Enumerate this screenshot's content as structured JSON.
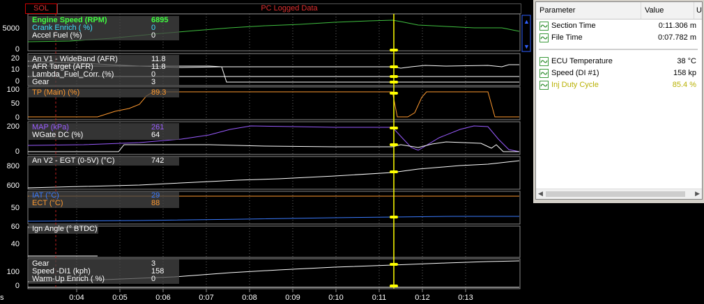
{
  "header": {
    "sol_label": "SOL",
    "title": "PC Logged Data"
  },
  "panels": [
    {
      "id": "engine",
      "yticks": [
        "5000",
        "0"
      ],
      "channels": [
        {
          "label": "Engine Speed (RPM)",
          "value": "6895",
          "color": "#40ff40"
        },
        {
          "label": "Crank Enrich ( %)",
          "value": "0",
          "color": "#40e0ff"
        },
        {
          "label": "Accel Fuel (%)",
          "value": "0",
          "color": "#ffffff"
        }
      ]
    },
    {
      "id": "afr",
      "yticks": [
        "20",
        "10",
        "0"
      ],
      "channels": [
        {
          "label": "An V1 - WideBand (AFR)",
          "value": "11.8",
          "color": "#ffffff"
        },
        {
          "label": "AFR Target (AFR)",
          "value": "11.8",
          "color": "#ffffff"
        },
        {
          "label": "Lambda_Fuel_Corr. (%)",
          "value": "0",
          "color": "#ffffff"
        },
        {
          "label": "Gear",
          "value": "3",
          "color": "#ffffff"
        }
      ]
    },
    {
      "id": "tp",
      "yticks": [
        "100",
        "50",
        "0"
      ],
      "channels": [
        {
          "label": "TP (Main) (%)",
          "value": "89.3",
          "color": "#ff9a30"
        }
      ]
    },
    {
      "id": "map",
      "yticks": [
        "200",
        "0"
      ],
      "channels": [
        {
          "label": "MAP (kPa)",
          "value": "261",
          "color": "#9a5cff"
        },
        {
          "label": "WGate DC (%)",
          "value": "64",
          "color": "#ffffff"
        }
      ]
    },
    {
      "id": "egt",
      "yticks": [
        "800",
        "600"
      ],
      "channels": [
        {
          "label": "An V2 - EGT (0-5V) (°C)",
          "value": "742",
          "color": "#ffffff"
        }
      ]
    },
    {
      "id": "temps",
      "yticks": [
        "50"
      ],
      "channels": [
        {
          "label": "IAT (°C)",
          "value": "29",
          "color": "#3a7bff"
        },
        {
          "label": "ECT (°C)",
          "value": "88",
          "color": "#ff9a30"
        }
      ]
    },
    {
      "id": "ign",
      "yticks": [
        "60",
        "40"
      ],
      "channels": [
        {
          "label": "Ign Angle (° BTDC)",
          "value": "",
          "color": "#ffffff"
        }
      ]
    },
    {
      "id": "speed",
      "yticks": [
        "100",
        "0"
      ],
      "channels": [
        {
          "label": "Gear",
          "value": "3",
          "color": "#ffffff"
        },
        {
          "label": "Speed -DI1 (kph)",
          "value": "158",
          "color": "#ffffff"
        },
        {
          "label": "Warm-Up Enrich ( %)",
          "value": "0",
          "color": "#ffffff"
        }
      ]
    }
  ],
  "x_axis": {
    "unit": "s",
    "ticks": [
      "0:04",
      "0:05",
      "0:06",
      "0:07",
      "0:08",
      "0:09",
      "0:10",
      "0:11",
      "0:12",
      "0:13"
    ]
  },
  "colors": {
    "cursor": "#ffff00",
    "marker": "#c02020",
    "grid": "#6a6a6a"
  },
  "param_panel": {
    "col_parameter": "Parameter",
    "col_value": "Value",
    "col_unit": "U",
    "group1": [
      {
        "name": "Section Time",
        "value": "0:11.306 m",
        "color": "#000000"
      },
      {
        "name": "File Time",
        "value": "0:07.782 m",
        "color": "#000000"
      }
    ],
    "group2": [
      {
        "name": "ECU Temperature",
        "value": "38 °C",
        "color": "#000000"
      },
      {
        "name": "Speed (DI #1)",
        "value": "158 kp",
        "color": "#000000"
      },
      {
        "name": "Inj Duty Cycle",
        "value": "85.4 %",
        "color": "#c8c000"
      }
    ],
    "icon": "wave-chart-icon"
  }
}
